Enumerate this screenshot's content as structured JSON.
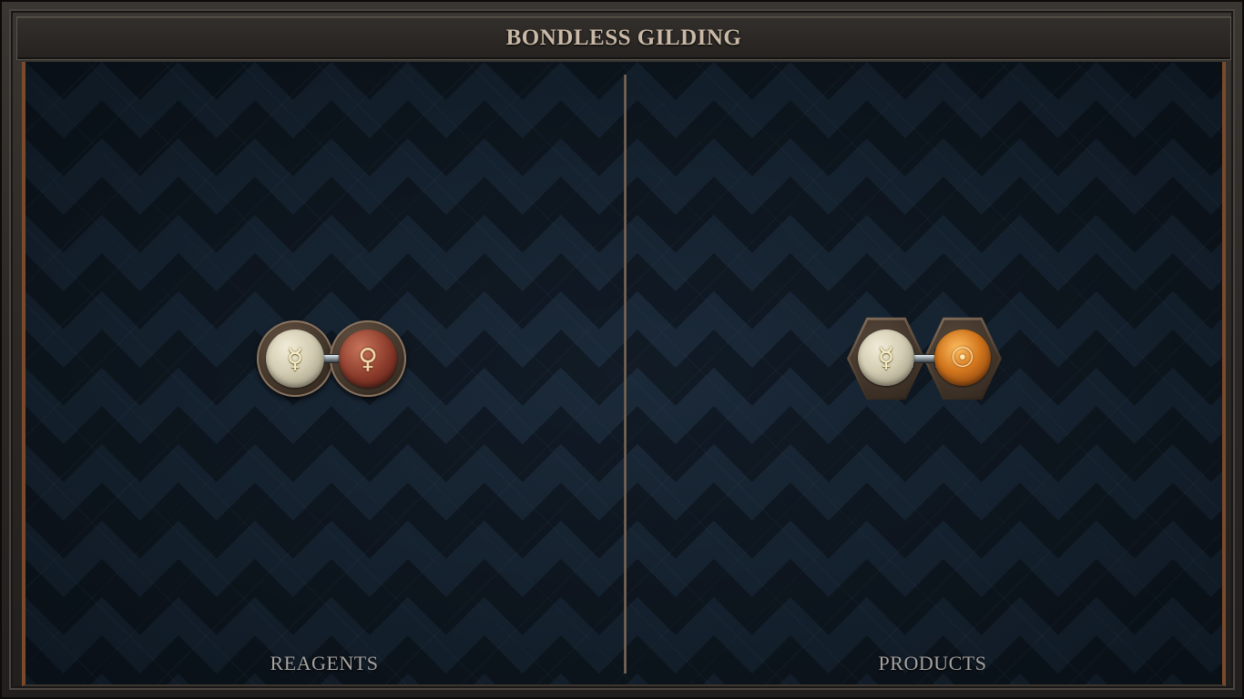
{
  "window": {
    "title": "BONDLESS GILDING"
  },
  "panels": {
    "reagents": {
      "label": "REAGENTS",
      "molecule": {
        "atoms": [
          {
            "element": "quicksilver",
            "glyph": "☿",
            "icon": "quicksilver-symbol-icon",
            "color": "#d4cdb3"
          },
          {
            "element": "copper",
            "glyph": "♀",
            "icon": "copper-symbol-icon",
            "color": "#8a3a2a"
          }
        ],
        "bonds": 1
      }
    },
    "products": {
      "label": "PRODUCTS",
      "molecule": {
        "atoms": [
          {
            "element": "quicksilver",
            "glyph": "☿",
            "icon": "quicksilver-symbol-icon",
            "color": "#d4cdb3"
          },
          {
            "element": "gold",
            "glyph": "☉",
            "icon": "gold-symbol-icon",
            "color": "#d2761d"
          }
        ],
        "bonds": 1
      }
    }
  },
  "colors": {
    "frame": "#2a2724",
    "board": "#101b26",
    "title_text": "#c9b9a6",
    "label_text": "#a5a29f",
    "accent_edge": "#7a4a2a"
  }
}
